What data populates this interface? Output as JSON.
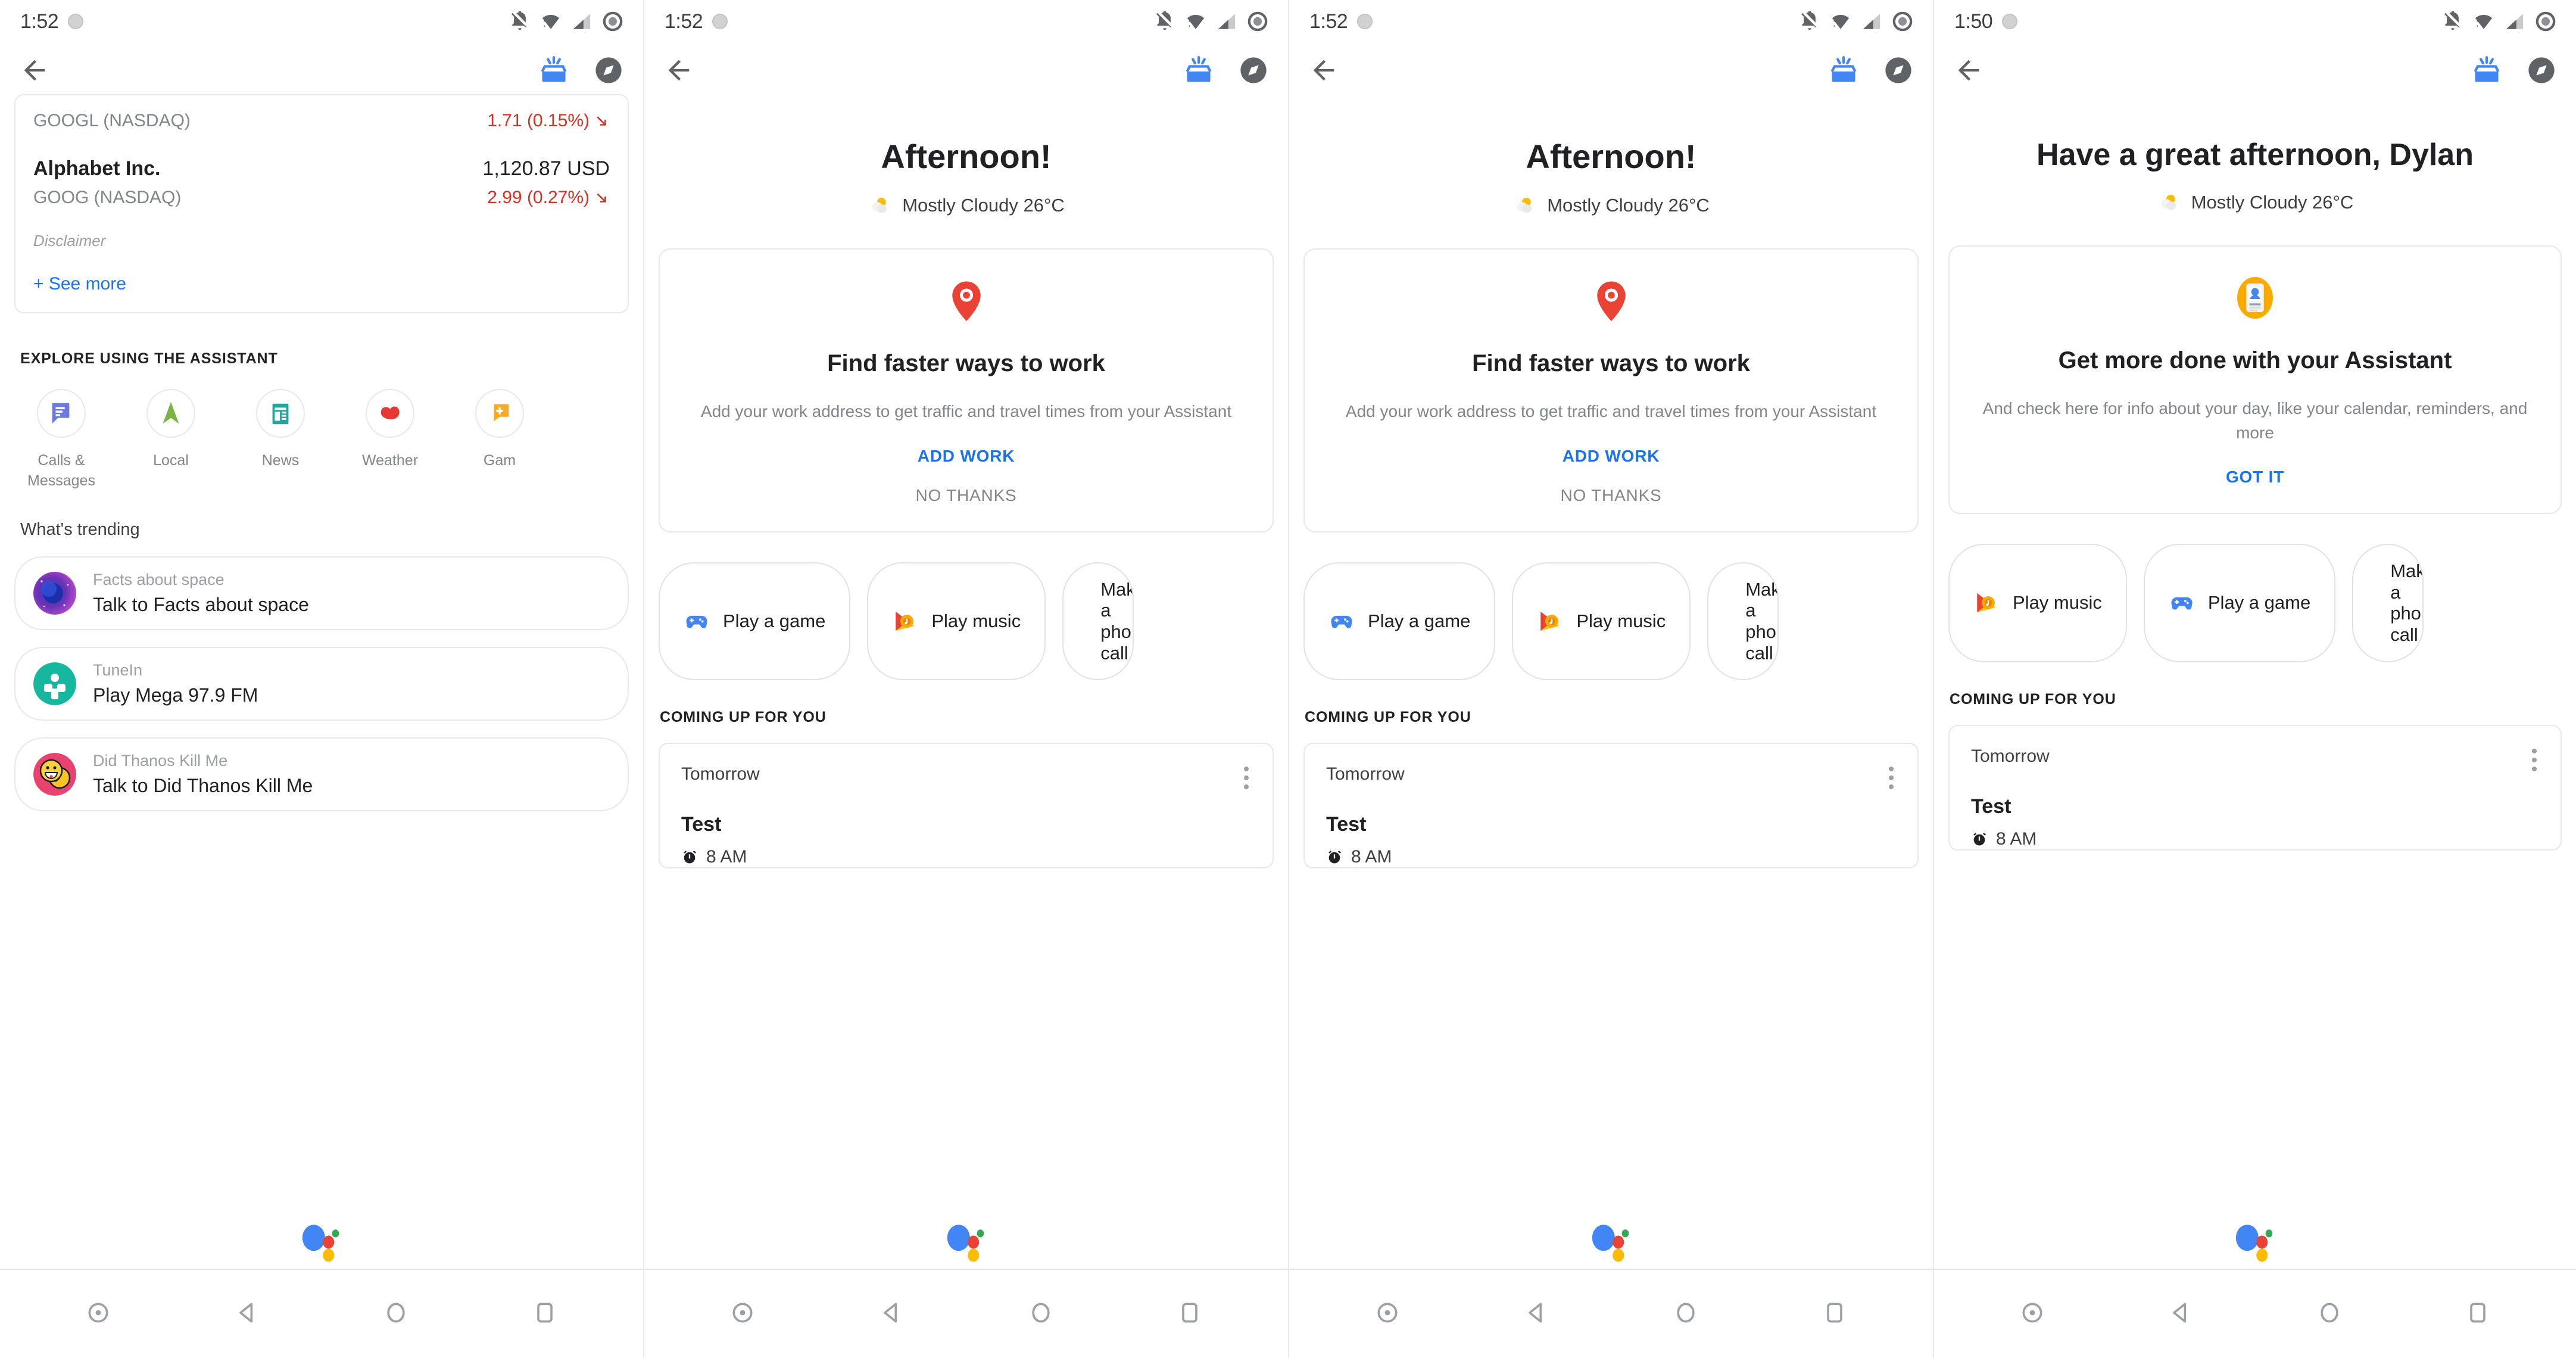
{
  "colors": {
    "accent_blue": "#1a73e8",
    "negative_red": "#d93025",
    "text_primary": "#202124",
    "text_secondary": "#80868b",
    "card_border": "#e6e8ea",
    "assistant_blue": "#4285f4",
    "assistant_red": "#ea4335",
    "assistant_yellow": "#fbbc04",
    "assistant_green": "#34a853"
  },
  "panels": [
    {
      "status_bar": {
        "time": "1:52"
      },
      "stock": {
        "row1_symbol": "GOOGL (NASDAQ)",
        "row1_delta": "1.71 (0.15%)",
        "row2_name": "Alphabet Inc.",
        "row2_price": "1,120.87 USD",
        "row2_symbol": "GOOG (NASDAQ)",
        "row2_delta": "2.99 (0.27%)",
        "disclaimer": "Disclaimer",
        "see_more": "+ See more"
      },
      "explore": {
        "heading": "EXPLORE USING THE ASSISTANT",
        "items": [
          {
            "label": "Calls & Messages",
            "icon": "messages-icon"
          },
          {
            "label": "Local",
            "icon": "navigation-arrow-icon"
          },
          {
            "label": "News",
            "icon": "newspaper-icon"
          },
          {
            "label": "Weather",
            "icon": "weather-heart-icon"
          },
          {
            "label": "Gam",
            "icon": "games-chat-plus-icon"
          }
        ]
      },
      "trending": {
        "heading": "What's trending",
        "items": [
          {
            "sub": "Facts about space",
            "main": "Talk to Facts about space",
            "avatar": "space-avatar"
          },
          {
            "sub": "TuneIn",
            "main": "Play Mega 97.9 FM",
            "avatar": "tunein-avatar"
          },
          {
            "sub": "Did Thanos Kill Me",
            "main": "Talk to Did Thanos Kill Me",
            "avatar": "thanos-avatar"
          }
        ]
      }
    },
    {
      "status_bar": {
        "time": "1:52"
      },
      "greeting": "Afternoon!",
      "weather": {
        "condition": "Mostly Cloudy 26°C",
        "icon": "partly-cloudy-icon"
      },
      "promo": {
        "icon": "map-pin-icon",
        "title": "Find faster ways to work",
        "body": "Add your work address to get traffic and travel times from your Assistant",
        "primary_action": "ADD WORK",
        "secondary_action": "NO THANKS"
      },
      "chips": [
        {
          "label": "Play a game",
          "icon": "gamepad-icon"
        },
        {
          "label": "Play music",
          "icon": "play-music-icon"
        },
        {
          "label": "Make a phone call",
          "icon": "phone-icon",
          "truncated": true
        }
      ],
      "coming_up": {
        "heading": "COMING UP FOR YOU",
        "day": "Tomorrow",
        "title": "Test",
        "time": "8 AM"
      }
    },
    {
      "status_bar": {
        "time": "1:52"
      },
      "greeting": "Afternoon!",
      "weather": {
        "condition": "Mostly Cloudy 26°C",
        "icon": "partly-cloudy-icon"
      },
      "promo": {
        "icon": "map-pin-icon",
        "title": "Find faster ways to work",
        "body": "Add your work address to get traffic and travel times from your Assistant",
        "primary_action": "ADD WORK",
        "secondary_action": "NO THANKS"
      },
      "chips": [
        {
          "label": "Play a game",
          "icon": "gamepad-icon"
        },
        {
          "label": "Play music",
          "icon": "play-music-icon"
        },
        {
          "label": "Make a phone call",
          "icon": "phone-icon",
          "truncated": true
        }
      ],
      "coming_up": {
        "heading": "COMING UP FOR YOU",
        "day": "Tomorrow",
        "title": "Test",
        "time": "8 AM"
      }
    },
    {
      "status_bar": {
        "time": "1:50"
      },
      "greeting": "Have a great afternoon, Dylan",
      "weather": {
        "condition": "Mostly Cloudy 26°C",
        "icon": "partly-cloudy-icon"
      },
      "promo": {
        "icon": "contact-card-icon",
        "title": "Get more done with your Assistant",
        "body": "And check here for info about your day, like your calendar, reminders, and more",
        "primary_action": "GOT IT",
        "secondary_action": ""
      },
      "chips": [
        {
          "label": "Play music",
          "icon": "play-music-icon"
        },
        {
          "label": "Play a game",
          "icon": "gamepad-icon"
        },
        {
          "label": "Make a phone call",
          "icon": "phone-icon",
          "truncated": true
        }
      ],
      "coming_up": {
        "heading": "COMING UP FOR YOU",
        "day": "Tomorrow",
        "title": "Test",
        "time": "8 AM"
      }
    }
  ],
  "nav_bar": {
    "items": [
      {
        "name": "assist-dot-button",
        "icon": "record-dot-icon"
      },
      {
        "name": "back-button",
        "icon": "triangle-back-icon"
      },
      {
        "name": "home-button",
        "icon": "circle-home-icon"
      },
      {
        "name": "recents-button",
        "icon": "square-recents-icon"
      }
    ]
  }
}
